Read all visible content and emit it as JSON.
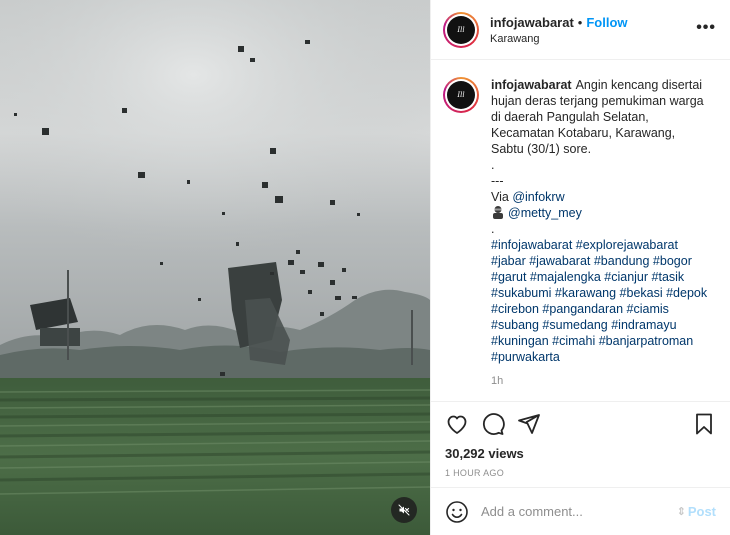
{
  "media": {
    "mute_icon": "speaker-muted-icon"
  },
  "header": {
    "username": "infojawabarat",
    "separator": "•",
    "follow_label": "Follow",
    "location": "Karawang",
    "avatar_text": "Ill",
    "more_icon": "more-options-icon"
  },
  "caption": {
    "username": "infojawabarat",
    "text_main": "Angin kencang disertai hujan deras terjang pemukiman warga di daerah Pangulah Selatan, Kecamatan Kotabaru, Karawang, Sabtu (30/1) sore.",
    "dot_line": ".",
    "dash_line": "---",
    "via_label": "Via",
    "via_mention": "@infokrw",
    "mention_2": "@metty_mey",
    "period_line": ".",
    "hashtags": "#infojawabarat #explorejawabarat #jabar #jawabarat #bandung #bogor #garut #majalengka #cianjur #tasik #sukabumi #karawang #bekasi #depok #cirebon #pangandaran #ciamis #subang #sumedang #indramayu #kuningan #cimahi #banjarpatroman #purwakarta",
    "time": "1h"
  },
  "actions": {
    "like_icon": "heart-icon",
    "comment_icon": "comment-icon",
    "share_icon": "share-icon",
    "save_icon": "bookmark-icon",
    "views": "30,292 views",
    "posted_ago": "1 HOUR AGO"
  },
  "comment_bar": {
    "emoji_icon": "emoji-icon",
    "placeholder": "Add a comment...",
    "post_label": "Post"
  }
}
